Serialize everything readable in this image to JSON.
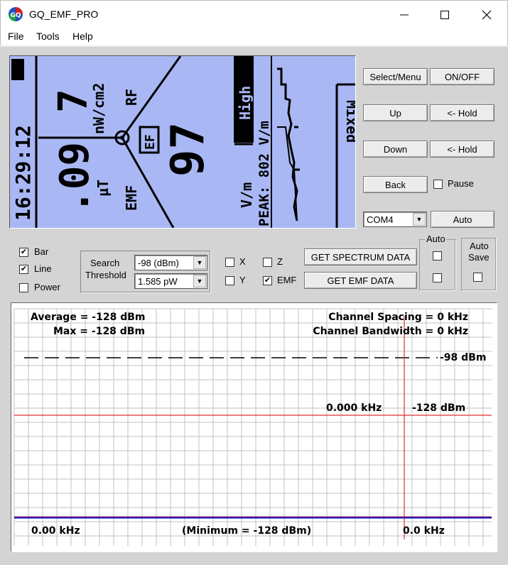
{
  "window": {
    "title": "GQ_EMF_PRO",
    "icon_letters": "GQ",
    "controls": [
      "minimize-icon",
      "maximize-icon",
      "close-icon"
    ]
  },
  "menu": [
    {
      "label": "File"
    },
    {
      "label": "Tools"
    },
    {
      "label": "Help"
    }
  ],
  "lcd": {
    "background": "#a9b8f4",
    "time": "16:29:12",
    "value_main": ".09",
    "unit_main": "µT",
    "value_rf": "7",
    "unit_rf": "nW/cm2",
    "label_rf": "RF",
    "label_emf": "EMF",
    "label_ef": "EF",
    "value_ef": "97",
    "unit_ef": "V/m",
    "level": "High",
    "peak": "PEAK: 802 V/m",
    "mode": "Mixed"
  },
  "buttons": {
    "select_menu": "Select/Menu",
    "on_off": "ON/OFF",
    "up": "Up",
    "hold1": "<- Hold",
    "down": "Down",
    "hold2": "<- Hold",
    "back": "Back",
    "pause": "Pause",
    "com_port": "COM4",
    "auto": "Auto",
    "get_spectrum": "GET SPECTRUM DATA",
    "get_emf": "GET EMF DATA"
  },
  "options": {
    "bar": {
      "label": "Bar",
      "checked": true
    },
    "line": {
      "label": "Line",
      "checked": true
    },
    "power": {
      "label": "Power",
      "checked": false
    },
    "x": {
      "label": "X",
      "checked": false
    },
    "y": {
      "label": "Y",
      "checked": false
    },
    "z": {
      "label": "Z",
      "checked": false
    },
    "emf": {
      "label": "EMF",
      "checked": true
    }
  },
  "search": {
    "label_line1": "Search",
    "label_line2": "Threshold",
    "threshold": "-98 (dBm)",
    "power": "1.585 pW"
  },
  "auto_group": {
    "title": "Auto"
  },
  "auto_save": {
    "line1": "Auto",
    "line2": "Save"
  },
  "graph": {
    "average": "Average = -128 dBm",
    "max": "Max = -128 dBm",
    "channel_spacing": "Channel Spacing = 0 kHz",
    "channel_bandwidth": "Channel Bandwidth = 0 kHz",
    "threshold_label": "-98 dBm",
    "cursor_freq": "0.000 kHz",
    "cursor_level": "-128 dBm",
    "x_start": "0.00 kHz",
    "minimum": "(Minimum = -128 dBm)",
    "x_end": "0.0 kHz",
    "colors": {
      "grid": "#c0c0c0",
      "cursor": "#e03030",
      "trace": "#1010c0",
      "threshold": "#000000"
    }
  }
}
